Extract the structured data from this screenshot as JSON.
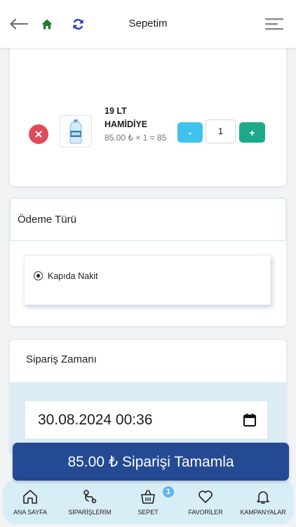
{
  "header": {
    "title": "Sepetim",
    "icons": {
      "back": "arrow-left-icon",
      "home": "home-icon",
      "refresh": "refresh-icon",
      "menu": "menu-icon"
    },
    "colors": {
      "home": "#1e7b2e",
      "refresh": "#2a3ab8"
    }
  },
  "cart": {
    "items": [
      {
        "name": "19 LT HAMİDİYE",
        "price_line": "85.00 ₺ × 1 = 85",
        "quantity": "1",
        "minus_label": "-",
        "plus_label": "+"
      }
    ]
  },
  "payment": {
    "title": "Ödeme Türü",
    "options": [
      {
        "label": "Kapıda Nakit",
        "selected": true
      }
    ]
  },
  "order_time": {
    "title": "Sipariş Zamanı",
    "value": "30.08.2024 00:36"
  },
  "complete": {
    "label": "85.00 ₺ Siparişi Tamamla",
    "color": "#244a94"
  },
  "nav": {
    "items": [
      {
        "label": "ANA SAYFA",
        "icon": "home-outline-icon"
      },
      {
        "label": "SİPARİŞLERİM",
        "icon": "route-icon"
      },
      {
        "label": "SEPET",
        "icon": "basket-icon"
      },
      {
        "label": "FAVORİLER",
        "icon": "heart-icon"
      },
      {
        "label": "KAMPANYALAR",
        "icon": "bell-icon"
      }
    ],
    "cart_badge": "1"
  },
  "colors": {
    "remove": "#e04b5b",
    "minus": "#3fc3ec",
    "plus": "#1ea88a",
    "nav_bg": "#d8eef6"
  }
}
